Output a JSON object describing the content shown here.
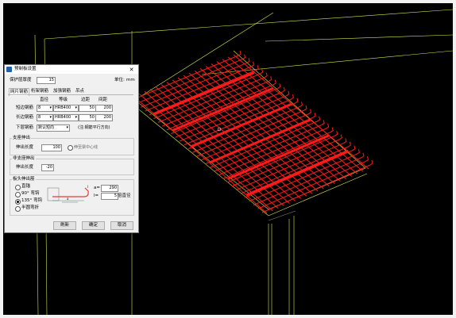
{
  "dialog": {
    "title": "预制板设置",
    "close": "✕",
    "cover_label": "保护层厚度",
    "cover_value": "15",
    "unit_label": "单位:",
    "unit_value": "mm",
    "tabs": [
      "网片钢筋",
      "桁架钢筋",
      "加强钢筋",
      "吊点"
    ],
    "columns": {
      "dia": "直径",
      "grade": "等级",
      "edge": "边距",
      "spacing": "间距"
    },
    "rows": [
      {
        "label": "短边钢筋",
        "dia": "8",
        "grade": "HRB400",
        "edge": "50",
        "spacing": "200"
      },
      {
        "label": "长边钢筋",
        "dia": "8",
        "grade": "HRB400",
        "edge": "50",
        "spacing": "200"
      }
    ],
    "lower_label": "下层钢筋",
    "lower_value": "默认短向",
    "lower_note": "(注:钢筋平行方向)",
    "group1": {
      "title": "支座伸出",
      "label": "伸出长度",
      "value": "100",
      "check_label": "伸至梁中心线"
    },
    "group2": {
      "title": "非支座伸出",
      "label": "伸出长度",
      "value": "-20"
    },
    "group3": {
      "title": "板头伸出筋",
      "options": [
        "直锚",
        "90° 弯钩",
        "135° 弯钩",
        "半圆弯折"
      ],
      "selected": 2,
      "a_label": "a=",
      "a_value": "290",
      "l_label": "l=",
      "l_value": "5",
      "l_unit": "倍直径",
      "diagram_a": "a",
      "diagram_l": "l"
    },
    "buttons": {
      "apply": "刷新",
      "ok": "确定",
      "cancel": "取消"
    }
  },
  "colors": {
    "canvas": "#000000",
    "rebar": "#ff1a1a",
    "outline": "#d6e84a",
    "dialog_bg": "#f0f0f0"
  }
}
